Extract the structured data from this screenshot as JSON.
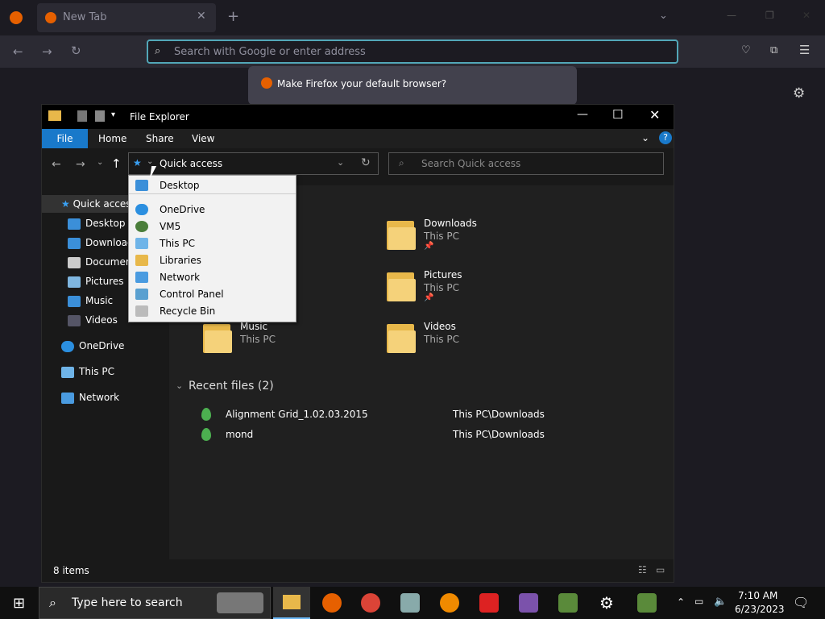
{
  "firefox": {
    "tab_title": "New Tab",
    "url_placeholder": "Search with Google or enter address",
    "default_notice": "Make Firefox your default browser?"
  },
  "explorer": {
    "window_title": "File Explorer",
    "ribbon_tabs": [
      "File",
      "Home",
      "Share",
      "View"
    ],
    "address": "Quick access",
    "search_placeholder": "Search Quick access",
    "nav": {
      "quick_access": "Quick access",
      "items": [
        "Desktop",
        "Downloads",
        "Documents",
        "Pictures",
        "Music",
        "Videos"
      ],
      "onedrive": "OneDrive",
      "this_pc": "This PC",
      "network": "Network"
    },
    "folders": [
      {
        "name": "Downloads",
        "location": "This PC"
      },
      {
        "name": "Pictures",
        "location": "This PC"
      },
      {
        "name": "Music",
        "location": "This PC"
      },
      {
        "name": "Videos",
        "location": "This PC"
      }
    ],
    "recent_header": "Recent files (2)",
    "recent": [
      {
        "name": "Alignment Grid_1.02.03.2015",
        "path": "This PC\\Downloads"
      },
      {
        "name": "mond",
        "path": "This PC\\Downloads"
      }
    ],
    "status": "8 items",
    "dropdown": [
      "Desktop",
      "OneDrive",
      "VM5",
      "This PC",
      "Libraries",
      "Network",
      "Control Panel",
      "Recycle Bin"
    ]
  },
  "taskbar": {
    "search_placeholder": "Type here to search",
    "time": "7:10 AM",
    "date": "6/23/2023"
  }
}
